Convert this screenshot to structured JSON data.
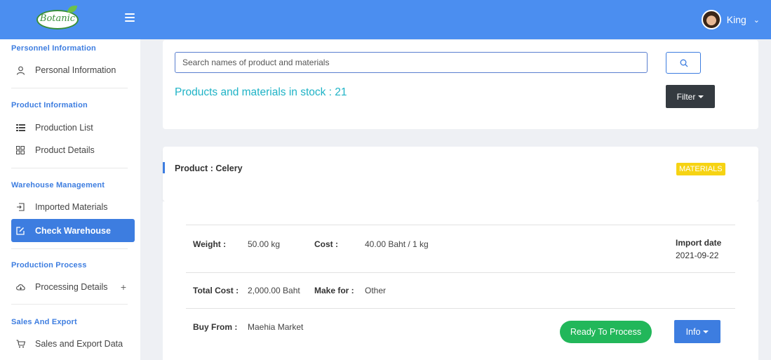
{
  "header": {
    "logo_text": "Botanic",
    "user_name": "King",
    "menu_icon": "hamburger-icon",
    "brand_color": "#4b8ef0"
  },
  "sidebar": {
    "sections": [
      {
        "title": "Personnel Information",
        "items": [
          {
            "label": "Personal Information",
            "icon": "user-icon"
          }
        ]
      },
      {
        "title": "Product Information",
        "items": [
          {
            "label": "Production List",
            "icon": "list-icon"
          },
          {
            "label": "Product Details",
            "icon": "grid-icon"
          }
        ]
      },
      {
        "title": "Warehouse Management",
        "items": [
          {
            "label": "Imported Materials",
            "icon": "import-icon"
          },
          {
            "label": "Check Warehouse",
            "icon": "edit-icon",
            "active": true
          }
        ]
      },
      {
        "title": "Production Process",
        "items": [
          {
            "label": "Processing Details",
            "icon": "cloud-icon",
            "expand": "+"
          }
        ]
      },
      {
        "title": "Sales And Export",
        "items": [
          {
            "label": "Sales and Export Data",
            "icon": "cart-icon"
          }
        ]
      }
    ]
  },
  "search": {
    "placeholder": "Search names of product and materials",
    "value": "",
    "button_icon": "search-icon"
  },
  "stock": {
    "text": "Products and materials in stock : 21"
  },
  "filter": {
    "label": "Filter"
  },
  "product": {
    "title": "Product : Celery",
    "badge": "MATERIALS",
    "badge_color": "#f6d313",
    "details": {
      "weight_label": "Weight :",
      "weight_value": "50.00 kg",
      "cost_label": "Cost :",
      "cost_value": "40.00 Baht / 1 kg",
      "import_label": "Import date",
      "import_value": "2021-09-22",
      "total_cost_label": "Total Cost :",
      "total_cost_value": "2,000.00 Baht",
      "make_for_label": "Make for :",
      "make_for_value": "Other",
      "buy_from_label": "Buy From :",
      "buy_from_value": "Maehia Market"
    },
    "status_button": "Ready To Process",
    "status_color": "#22b75a",
    "info_button": "Info"
  }
}
